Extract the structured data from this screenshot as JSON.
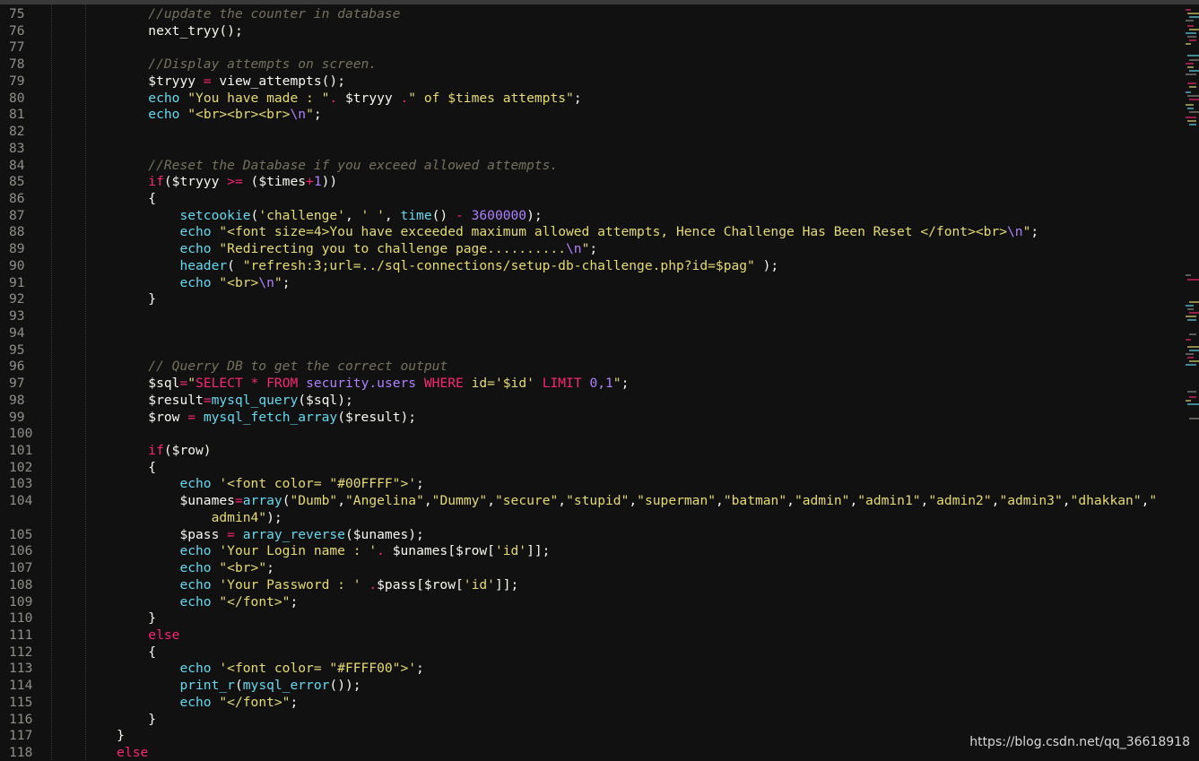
{
  "editor": {
    "colors": {
      "background": "#111111",
      "comment": "#75715e",
      "string": "#e6db74",
      "keyword": "#f92672",
      "function": "#66d9ef",
      "number": "#ae81ff",
      "plain": "#f8f8f2",
      "line_number": "#8f908a"
    },
    "lines": [
      {
        "n": "75",
        "indent": 8,
        "tokens": [
          [
            "c",
            "//update the counter in database"
          ]
        ]
      },
      {
        "n": "76",
        "indent": 8,
        "tokens": [
          [
            "p",
            "next_tryy();"
          ]
        ]
      },
      {
        "n": "77",
        "indent": 0,
        "tokens": []
      },
      {
        "n": "78",
        "indent": 8,
        "tokens": [
          [
            "c",
            "//Display attempts on screen."
          ]
        ]
      },
      {
        "n": "79",
        "indent": 8,
        "tokens": [
          [
            "p",
            "$tryyy "
          ],
          [
            "k",
            "="
          ],
          [
            "p",
            " view_attempts();"
          ]
        ]
      },
      {
        "n": "80",
        "indent": 8,
        "tokens": [
          [
            "f",
            "echo"
          ],
          [
            "p",
            " "
          ],
          [
            "s",
            "\"You have made : \""
          ],
          [
            "k",
            "."
          ],
          [
            "p",
            " $tryyy "
          ],
          [
            "k",
            "."
          ],
          [
            "s",
            "\" of $times attempts\""
          ],
          [
            "p",
            ";"
          ]
        ]
      },
      {
        "n": "81",
        "indent": 8,
        "tokens": [
          [
            "f",
            "echo"
          ],
          [
            "p",
            " "
          ],
          [
            "s",
            "\"<br><br><br>"
          ],
          [
            "e",
            "\\n"
          ],
          [
            "s",
            "\""
          ],
          [
            "p",
            ";"
          ]
        ]
      },
      {
        "n": "82",
        "indent": 0,
        "tokens": []
      },
      {
        "n": "83",
        "indent": 0,
        "tokens": []
      },
      {
        "n": "84",
        "indent": 8,
        "tokens": [
          [
            "c",
            "//Reset the Database if you exceed allowed attempts."
          ]
        ]
      },
      {
        "n": "85",
        "indent": 8,
        "tokens": [
          [
            "k",
            "if"
          ],
          [
            "p",
            "($tryyy "
          ],
          [
            "k",
            ">="
          ],
          [
            "p",
            " ($times"
          ],
          [
            "k",
            "+"
          ],
          [
            "n",
            "1"
          ],
          [
            "p",
            "))"
          ]
        ]
      },
      {
        "n": "86",
        "indent": 8,
        "tokens": [
          [
            "p",
            "{"
          ]
        ]
      },
      {
        "n": "87",
        "indent": 12,
        "tokens": [
          [
            "f",
            "setcookie"
          ],
          [
            "p",
            "("
          ],
          [
            "s",
            "'challenge'"
          ],
          [
            "p",
            ", "
          ],
          [
            "s",
            "' '"
          ],
          [
            "p",
            ", "
          ],
          [
            "f",
            "time"
          ],
          [
            "p",
            "() "
          ],
          [
            "k",
            "-"
          ],
          [
            "p",
            " "
          ],
          [
            "n",
            "3600000"
          ],
          [
            "p",
            ");"
          ]
        ]
      },
      {
        "n": "88",
        "indent": 12,
        "tokens": [
          [
            "f",
            "echo"
          ],
          [
            "p",
            " "
          ],
          [
            "s",
            "\"<font size=4>You have exceeded maximum allowed attempts, Hence Challenge Has Been Reset </font><br>"
          ],
          [
            "e",
            "\\n"
          ],
          [
            "s",
            "\""
          ],
          [
            "p",
            ";"
          ]
        ]
      },
      {
        "n": "89",
        "indent": 12,
        "tokens": [
          [
            "f",
            "echo"
          ],
          [
            "p",
            " "
          ],
          [
            "s",
            "\"Redirecting you to challenge page.........."
          ],
          [
            "e",
            "\\n"
          ],
          [
            "s",
            "\""
          ],
          [
            "p",
            ";"
          ]
        ]
      },
      {
        "n": "90",
        "indent": 12,
        "tokens": [
          [
            "f",
            "header"
          ],
          [
            "p",
            "( "
          ],
          [
            "s",
            "\"refresh:3;url=../sql-connections/setup-db-challenge.php?id=$pag\""
          ],
          [
            "p",
            " );"
          ]
        ]
      },
      {
        "n": "91",
        "indent": 12,
        "tokens": [
          [
            "f",
            "echo"
          ],
          [
            "p",
            " "
          ],
          [
            "s",
            "\"<br>"
          ],
          [
            "e",
            "\\n"
          ],
          [
            "s",
            "\""
          ],
          [
            "p",
            ";"
          ]
        ]
      },
      {
        "n": "92",
        "indent": 8,
        "tokens": [
          [
            "p",
            "}"
          ]
        ]
      },
      {
        "n": "93",
        "indent": 0,
        "tokens": []
      },
      {
        "n": "94",
        "indent": 0,
        "tokens": []
      },
      {
        "n": "95",
        "indent": 0,
        "tokens": []
      },
      {
        "n": "96",
        "indent": 8,
        "tokens": [
          [
            "c",
            "// Querry DB to get the correct output"
          ]
        ]
      },
      {
        "n": "97",
        "indent": 8,
        "tokens": [
          [
            "p",
            "$sql"
          ],
          [
            "k",
            "="
          ],
          [
            "s",
            "\""
          ],
          [
            "k",
            "SELECT * FROM"
          ],
          [
            "p",
            " "
          ],
          [
            "v",
            "security.users"
          ],
          [
            "p",
            " "
          ],
          [
            "k",
            "WHERE"
          ],
          [
            "s",
            " id='$id' "
          ],
          [
            "k",
            "LIMIT"
          ],
          [
            "p",
            " "
          ],
          [
            "n",
            "0,1"
          ],
          [
            "s",
            "\""
          ],
          [
            "p",
            ";"
          ]
        ]
      },
      {
        "n": "98",
        "indent": 8,
        "tokens": [
          [
            "p",
            "$result"
          ],
          [
            "k",
            "="
          ],
          [
            "f",
            "mysql_query"
          ],
          [
            "p",
            "($sql);"
          ]
        ]
      },
      {
        "n": "99",
        "indent": 8,
        "tokens": [
          [
            "p",
            "$row "
          ],
          [
            "k",
            "="
          ],
          [
            "p",
            " "
          ],
          [
            "f",
            "mysql_fetch_array"
          ],
          [
            "p",
            "($result);"
          ]
        ]
      },
      {
        "n": "100",
        "indent": 0,
        "tokens": []
      },
      {
        "n": "101",
        "indent": 8,
        "tokens": [
          [
            "k",
            "if"
          ],
          [
            "p",
            "($row)"
          ]
        ]
      },
      {
        "n": "102",
        "indent": 8,
        "tokens": [
          [
            "p",
            "{"
          ]
        ]
      },
      {
        "n": "103",
        "indent": 12,
        "tokens": [
          [
            "f",
            "echo"
          ],
          [
            "p",
            " "
          ],
          [
            "s",
            "'<font color= \"#00FFFF\">'"
          ],
          [
            "p",
            ";"
          ]
        ]
      },
      {
        "n": "104",
        "indent": 12,
        "tokens": [
          [
            "p",
            "$unames"
          ],
          [
            "k",
            "="
          ],
          [
            "f",
            "array"
          ],
          [
            "p",
            "("
          ],
          [
            "s",
            "\"Dumb\""
          ],
          [
            "p",
            ","
          ],
          [
            "s",
            "\"Angelina\""
          ],
          [
            "p",
            ","
          ],
          [
            "s",
            "\"Dummy\""
          ],
          [
            "p",
            ","
          ],
          [
            "s",
            "\"secure\""
          ],
          [
            "p",
            ","
          ],
          [
            "s",
            "\"stupid\""
          ],
          [
            "p",
            ","
          ],
          [
            "s",
            "\"superman\""
          ],
          [
            "p",
            ","
          ],
          [
            "s",
            "\"batman\""
          ],
          [
            "p",
            ","
          ],
          [
            "s",
            "\"admin\""
          ],
          [
            "p",
            ","
          ],
          [
            "s",
            "\"admin1\""
          ],
          [
            "p",
            ","
          ],
          [
            "s",
            "\"admin2\""
          ],
          [
            "p",
            ","
          ],
          [
            "s",
            "\"admin3\""
          ],
          [
            "p",
            ","
          ],
          [
            "s",
            "\"dhakkan\""
          ],
          [
            "p",
            ","
          ],
          [
            "s",
            "\""
          ],
          [
            "wrap",
            "    "
          ],
          [
            "s",
            "admin4\""
          ],
          [
            "p",
            ");"
          ]
        ]
      },
      {
        "n": "105",
        "indent": 12,
        "tokens": [
          [
            "p",
            "$pass "
          ],
          [
            "k",
            "="
          ],
          [
            "p",
            " "
          ],
          [
            "f",
            "array_reverse"
          ],
          [
            "p",
            "($unames);"
          ]
        ]
      },
      {
        "n": "106",
        "indent": 12,
        "tokens": [
          [
            "f",
            "echo"
          ],
          [
            "p",
            " "
          ],
          [
            "s",
            "'Your Login name : '"
          ],
          [
            "k",
            "."
          ],
          [
            "p",
            " $unames[$row["
          ],
          [
            "s",
            "'id'"
          ],
          [
            "p",
            "]];"
          ]
        ]
      },
      {
        "n": "107",
        "indent": 12,
        "tokens": [
          [
            "f",
            "echo"
          ],
          [
            "p",
            " "
          ],
          [
            "s",
            "\"<br>\""
          ],
          [
            "p",
            ";"
          ]
        ]
      },
      {
        "n": "108",
        "indent": 12,
        "tokens": [
          [
            "f",
            "echo"
          ],
          [
            "p",
            " "
          ],
          [
            "s",
            "'Your Password : '"
          ],
          [
            "p",
            " "
          ],
          [
            "k",
            "."
          ],
          [
            "p",
            "$pass[$row["
          ],
          [
            "s",
            "'id'"
          ],
          [
            "p",
            "]];"
          ]
        ]
      },
      {
        "n": "109",
        "indent": 12,
        "tokens": [
          [
            "f",
            "echo"
          ],
          [
            "p",
            " "
          ],
          [
            "s",
            "\"</font>\""
          ],
          [
            "p",
            ";"
          ]
        ]
      },
      {
        "n": "110",
        "indent": 8,
        "tokens": [
          [
            "p",
            "}"
          ]
        ]
      },
      {
        "n": "111",
        "indent": 8,
        "tokens": [
          [
            "k",
            "else"
          ]
        ]
      },
      {
        "n": "112",
        "indent": 8,
        "tokens": [
          [
            "p",
            "{"
          ]
        ]
      },
      {
        "n": "113",
        "indent": 12,
        "tokens": [
          [
            "f",
            "echo"
          ],
          [
            "p",
            " "
          ],
          [
            "s",
            "'<font color= \"#FFFF00\">'"
          ],
          [
            "p",
            ";"
          ]
        ]
      },
      {
        "n": "114",
        "indent": 12,
        "tokens": [
          [
            "f",
            "print_r"
          ],
          [
            "p",
            "("
          ],
          [
            "f",
            "mysql_error"
          ],
          [
            "p",
            "());"
          ]
        ]
      },
      {
        "n": "115",
        "indent": 12,
        "tokens": [
          [
            "f",
            "echo"
          ],
          [
            "p",
            " "
          ],
          [
            "s",
            "\"</font>\""
          ],
          [
            "p",
            ";"
          ]
        ]
      },
      {
        "n": "116",
        "indent": 8,
        "tokens": [
          [
            "p",
            "}"
          ]
        ]
      },
      {
        "n": "117",
        "indent": 4,
        "tokens": [
          [
            "p",
            "}"
          ]
        ]
      },
      {
        "n": "118",
        "indent": 4,
        "tokens": [
          [
            "k",
            "else"
          ]
        ]
      }
    ]
  },
  "watermark": "https://blog.csdn.net/qq_36618918"
}
